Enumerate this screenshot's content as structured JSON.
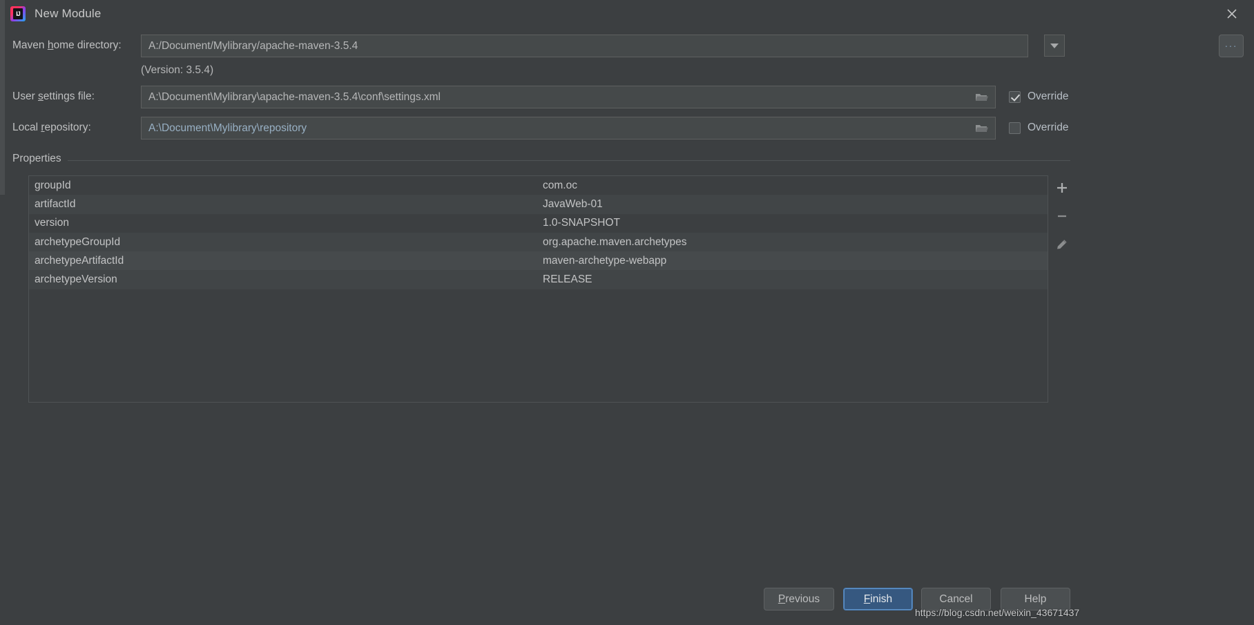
{
  "window": {
    "title": "New Module",
    "app_icon": "intellij-idea-icon",
    "close_icon": "close-icon"
  },
  "form": {
    "maven_home": {
      "label_prefix": "Maven ",
      "label_mnemonic": "h",
      "label_suffix": "ome directory:",
      "label_full": "Maven home directory:",
      "value": "A:/Document/Mylibrary/apache-maven-3.5.4",
      "dropdown_icon": "chevron-down-icon",
      "browse_label": "...",
      "version_note": "(Version: 3.5.4)"
    },
    "user_settings": {
      "label_prefix": "User ",
      "label_mnemonic": "s",
      "label_suffix": "ettings file:",
      "label_full": "User settings file:",
      "value": "A:\\Document\\Mylibrary\\apache-maven-3.5.4\\conf\\settings.xml",
      "folder_icon": "folder-icon",
      "override_label": "Override",
      "override_checked": true
    },
    "local_repository": {
      "label_prefix": "Local ",
      "label_mnemonic": "r",
      "label_suffix": "epository:",
      "label_full": "Local repository:",
      "value": "A:\\Document\\Mylibrary\\repository",
      "folder_icon": "folder-icon",
      "override_label": "Override",
      "override_checked": false
    }
  },
  "properties": {
    "group_label": "Properties",
    "rows": [
      {
        "key": "groupId",
        "value": "com.oc"
      },
      {
        "key": "artifactId",
        "value": "JavaWeb-01"
      },
      {
        "key": "version",
        "value": "1.0-SNAPSHOT"
      },
      {
        "key": "archetypeGroupId",
        "value": "org.apache.maven.archetypes"
      },
      {
        "key": "archetypeArtifactId",
        "value": "maven-archetype-webapp"
      },
      {
        "key": "archetypeVersion",
        "value": "RELEASE"
      }
    ],
    "toolbar": {
      "add_icon": "plus-icon",
      "remove_icon": "minus-icon",
      "edit_icon": "pencil-icon"
    }
  },
  "footer": {
    "previous": {
      "prefix": "",
      "mnemonic": "P",
      "suffix": "revious",
      "full": "Previous"
    },
    "finish": {
      "prefix": "",
      "mnemonic": "F",
      "suffix": "inish",
      "full": "Finish"
    },
    "cancel": {
      "full": "Cancel"
    },
    "help": {
      "full": "Help"
    }
  },
  "watermark": "https://blog.csdn.net/weixin_43671437",
  "colors": {
    "dialog_bg": "#3c3f41",
    "field_bg": "#45494a",
    "row_alt": "#414547",
    "primary_button": "#365880",
    "inherited_text": "#98b0c4"
  }
}
